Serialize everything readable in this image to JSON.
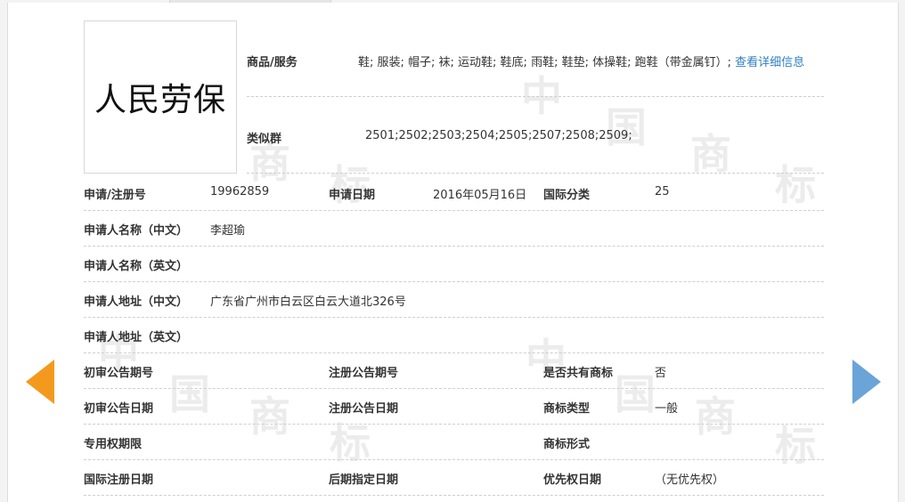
{
  "logo": {
    "text": "人民劳保"
  },
  "goods": {
    "label": "商品/服务",
    "items": "鞋; 服装; 帽子; 袜; 运动鞋; 鞋底; 雨鞋; 鞋垫; 体操鞋; 跑鞋（带金属钉）;",
    "more_link": "查看详细信息"
  },
  "similar_group": {
    "label": "类似群",
    "value": "2501;2502;2503;2504;2505;2507;2508;2509;"
  },
  "record": {
    "reg_no_label": "申请/注册号",
    "reg_no": "19962859",
    "apply_date_label": "申请日期",
    "apply_date": "2016年05月16日",
    "intl_class_label": "国际分类",
    "intl_class": "25",
    "applicant_cn_label": "申请人名称（中文）",
    "applicant_cn": "李超瑜",
    "applicant_en_label": "申请人名称（英文）",
    "address_cn_label": "申请人地址（中文）",
    "address_cn": "广东省广州市白云区白云大道北326号",
    "address_en_label": "申请人地址（英文）",
    "prelim_no_label": "初审公告期号",
    "reg_pub_no_label": "注册公告期号",
    "shared_label": "是否共有商标",
    "shared": "否",
    "prelim_date_label": "初审公告日期",
    "reg_pub_date_label": "注册公告日期",
    "mark_type_label": "商标类型",
    "mark_type": "一般",
    "exclusive_period_label": "专用权期限",
    "mark_form_label": "商标形式",
    "intl_reg_date_label": "国际注册日期",
    "later_designation_label": "后期指定日期",
    "priority_date_label": "优先权日期",
    "priority_date": "（无优先权）"
  },
  "watermark": {
    "chars": [
      "中",
      "国",
      "商",
      "标"
    ]
  },
  "nav": {
    "prev_icon": "arrow-left-icon",
    "next_icon": "arrow-right-icon"
  },
  "colors": {
    "link": "#2f7fc1",
    "prev_arrow": "#f39a1e",
    "next_arrow": "#6aa4d8"
  }
}
